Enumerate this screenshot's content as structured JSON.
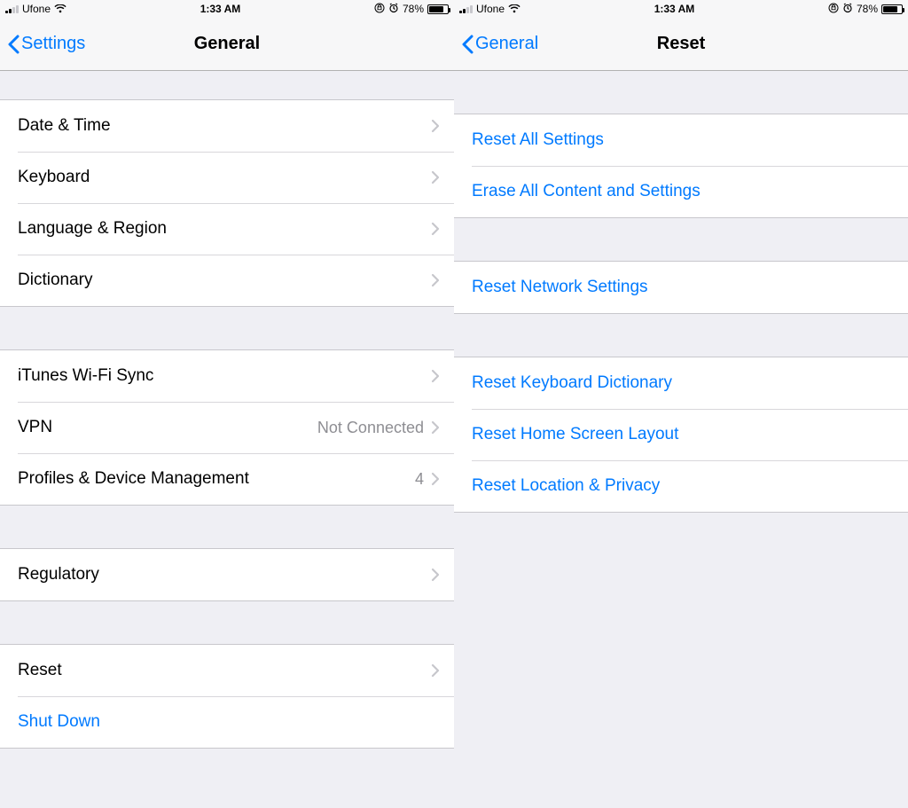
{
  "status": {
    "carrier": "Ufone",
    "time": "1:33 AM",
    "battery_pct": "78%"
  },
  "left": {
    "back_label": "Settings",
    "title": "General",
    "groups": [
      {
        "rows": [
          {
            "label": "Date & Time",
            "value": "",
            "link": true,
            "chevron": true
          },
          {
            "label": "Keyboard",
            "value": "",
            "link": true,
            "chevron": true
          },
          {
            "label": "Language & Region",
            "value": "",
            "link": true,
            "chevron": true
          },
          {
            "label": "Dictionary",
            "value": "",
            "link": true,
            "chevron": true
          }
        ]
      },
      {
        "rows": [
          {
            "label": "iTunes Wi-Fi Sync",
            "value": "",
            "link": true,
            "chevron": true
          },
          {
            "label": "VPN",
            "value": "Not Connected",
            "link": true,
            "chevron": true
          },
          {
            "label": "Profiles & Device Management",
            "value": "4",
            "link": true,
            "chevron": true
          }
        ]
      },
      {
        "rows": [
          {
            "label": "Regulatory",
            "value": "",
            "link": true,
            "chevron": true
          }
        ]
      },
      {
        "rows": [
          {
            "label": "Reset",
            "value": "",
            "link": true,
            "chevron": true
          },
          {
            "label": "Shut Down",
            "value": "",
            "link": true,
            "chevron": false,
            "blue": true
          }
        ]
      }
    ]
  },
  "right": {
    "back_label": "General",
    "title": "Reset",
    "groups": [
      {
        "rows": [
          {
            "label": "Reset All Settings",
            "blue": true
          },
          {
            "label": "Erase All Content and Settings",
            "blue": true
          }
        ]
      },
      {
        "rows": [
          {
            "label": "Reset Network Settings",
            "blue": true
          }
        ]
      },
      {
        "rows": [
          {
            "label": "Reset Keyboard Dictionary",
            "blue": true
          },
          {
            "label": "Reset Home Screen Layout",
            "blue": true
          },
          {
            "label": "Reset Location & Privacy",
            "blue": true
          }
        ]
      }
    ]
  }
}
